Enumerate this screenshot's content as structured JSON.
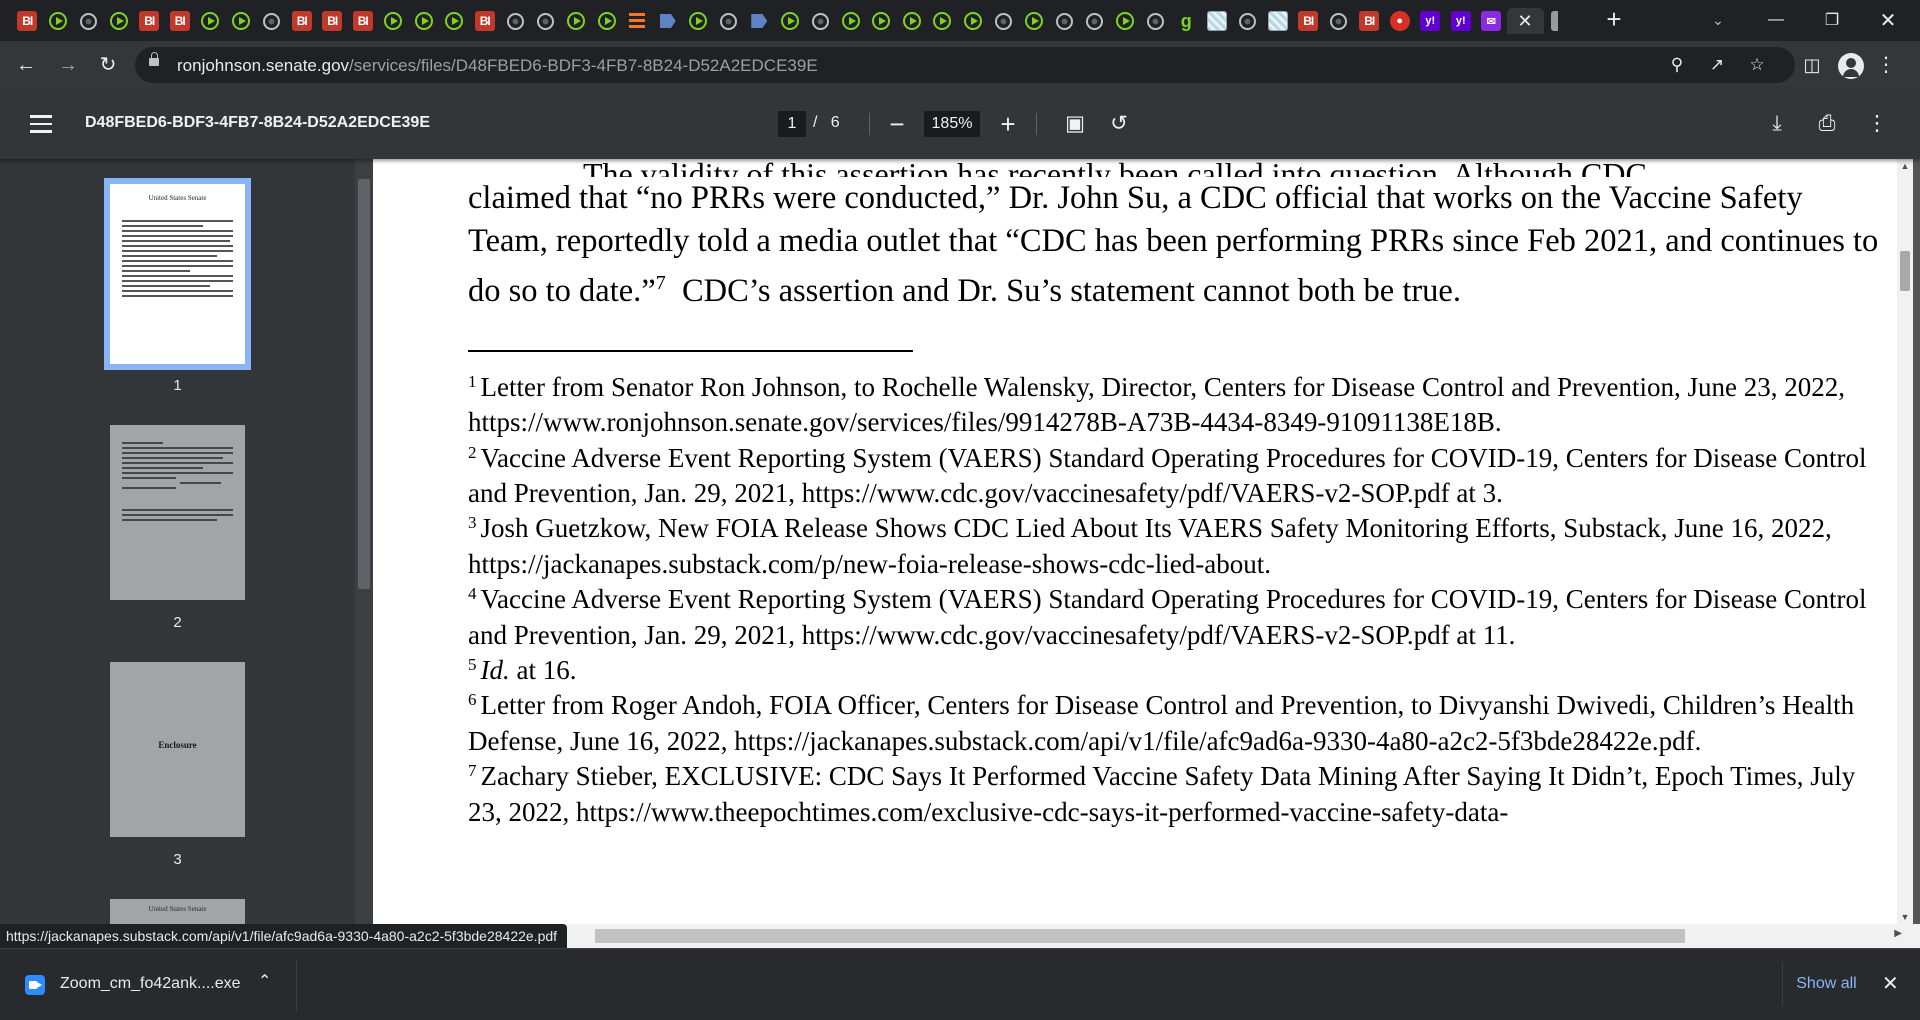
{
  "browser": {
    "tabs": [
      {
        "icon": "bi-icon",
        "text": "BI"
      },
      {
        "icon": "play-icon",
        "text": ""
      },
      {
        "icon": "globe-icon",
        "text": ""
      },
      {
        "icon": "play-icon",
        "text": ""
      },
      {
        "icon": "bi-icon",
        "text": "BI"
      },
      {
        "icon": "bi-icon",
        "text": "BI"
      },
      {
        "icon": "play-icon",
        "text": ""
      },
      {
        "icon": "play-icon",
        "text": ""
      },
      {
        "icon": "globe-icon",
        "text": ""
      },
      {
        "icon": "bi-icon",
        "text": "BI"
      },
      {
        "icon": "bi-icon",
        "text": "BI"
      },
      {
        "icon": "bi-icon",
        "text": "BI"
      },
      {
        "icon": "play-icon",
        "text": ""
      },
      {
        "icon": "play-icon",
        "text": ""
      },
      {
        "icon": "play-icon",
        "text": ""
      },
      {
        "icon": "bi-icon",
        "text": "BI"
      },
      {
        "icon": "globe-icon",
        "text": ""
      },
      {
        "icon": "globe-icon",
        "text": ""
      },
      {
        "icon": "play-icon",
        "text": ""
      },
      {
        "icon": "play-icon",
        "text": ""
      },
      {
        "icon": "orange-bars-icon",
        "text": ""
      },
      {
        "icon": "bookmark-icon",
        "text": ""
      },
      {
        "icon": "play-icon",
        "text": ""
      },
      {
        "icon": "globe-icon",
        "text": ""
      },
      {
        "icon": "bookmark-icon",
        "text": ""
      },
      {
        "icon": "play-icon",
        "text": ""
      },
      {
        "icon": "globe-icon",
        "text": ""
      },
      {
        "icon": "play-icon",
        "text": ""
      },
      {
        "icon": "play-icon",
        "text": ""
      },
      {
        "icon": "play-icon",
        "text": ""
      },
      {
        "icon": "play-icon",
        "text": ""
      },
      {
        "icon": "play-icon",
        "text": ""
      },
      {
        "icon": "globe-icon",
        "text": ""
      },
      {
        "icon": "play-icon",
        "text": ""
      },
      {
        "icon": "globe-icon",
        "text": ""
      },
      {
        "icon": "globe-icon",
        "text": ""
      },
      {
        "icon": "play-icon",
        "text": ""
      },
      {
        "icon": "globe-icon",
        "text": ""
      },
      {
        "icon": "g-icon",
        "text": "g"
      },
      {
        "icon": "grid-icon",
        "text": ""
      },
      {
        "icon": "globe-icon",
        "text": ""
      },
      {
        "icon": "grid-icon",
        "text": ""
      },
      {
        "icon": "bi-icon",
        "text": "BI"
      },
      {
        "icon": "globe-icon",
        "text": ""
      },
      {
        "icon": "bi-icon",
        "text": "BI"
      },
      {
        "icon": "red-pin-icon",
        "text": "●"
      },
      {
        "icon": "yahoo-icon",
        "text": "y!"
      },
      {
        "icon": "yahoo-icon",
        "text": "y!"
      },
      {
        "icon": "mail-icon",
        "text": "✉"
      },
      {
        "icon": "pdf-tab-icon",
        "text": "",
        "active": true
      },
      {
        "icon": "stripe-icon",
        "text": ""
      }
    ],
    "new_tab_symbol": "+",
    "url_host": "ronjohnson.senate.gov",
    "url_path": "/services/files/D48FBED6-BDF3-4FB7-8B24-D52A2EDCE39E",
    "accent_color": "#8ab4f8"
  },
  "pdf_toolbar": {
    "title": "D48FBED6-BDF3-4FB7-8B24-D52A2EDCE39E",
    "current_page": "1",
    "page_separator": "/",
    "total_pages": "6",
    "zoom": "185%"
  },
  "sidebar": {
    "thumbnails": [
      {
        "page": "1",
        "label": "United States Senate",
        "selected": true
      },
      {
        "page": "2",
        "label": "",
        "selected": false
      },
      {
        "page": "3",
        "label": "Enclosure",
        "selected": false
      },
      {
        "page": "4",
        "label": "United States Senate",
        "selected": false
      }
    ]
  },
  "document": {
    "cut_off_line": "The validity of this assertion has recently been called into question. Although CDC",
    "paragraph": "claimed that “no PRRs were conducted,” Dr. John Su, a CDC official that works on the Vaccine Safety Team, reportedly told a media outlet that “CDC has been performing PRRs since Feb 2021, and continues to do so to date.”",
    "paragraph_footnote_ref": "7",
    "paragraph_tail": "CDC’s assertion and Dr. Su’s statement cannot both be true.",
    "footnotes": [
      {
        "num": "1",
        "text": "Letter from Senator Ron Johnson, to Rochelle Walensky, Director, Centers for Disease Control and Prevention, June 23, 2022, https://www.ronjohnson.senate.gov/services/files/9914278B-A73B-4434-8349-91091138E18B."
      },
      {
        "num": "2",
        "text": "Vaccine Adverse Event Reporting System (VAERS) Standard Operating Procedures for COVID-19, Centers for Disease Control and Prevention, Jan. 29, 2021, https://www.cdc.gov/vaccinesafety/pdf/VAERS-v2-SOP.pdf at 3."
      },
      {
        "num": "3",
        "text": "Josh Guetzkow, New FOIA Release Shows CDC Lied About Its VAERS Safety Monitoring Efforts, Substack, June 16, 2022, https://jackanapes.substack.com/p/new-foia-release-shows-cdc-lied-about."
      },
      {
        "num": "4",
        "text": "Vaccine Adverse Event Reporting System (VAERS) Standard Operating Procedures for COVID-19, Centers for Disease Control and Prevention, Jan. 29, 2021, https://www.cdc.gov/vaccinesafety/pdf/VAERS-v2-SOP.pdf at 11."
      },
      {
        "num": "5",
        "italic": "Id.",
        "text": " at 16."
      },
      {
        "num": "6",
        "text": "Letter from Roger Andoh, FOIA Officer, Centers for Disease Control and Prevention, to Divyanshi Dwivedi, Children’s Health Defense, June 16, 2022, https://jackanapes.substack.com/api/v1/file/afc9ad6a-9330-4a80-a2c2-5f3bde28422e.pdf."
      },
      {
        "num": "7",
        "text": "Zachary Stieber, EXCLUSIVE: CDC Says It Performed Vaccine Safety Data Mining After Saying It Didn’t, Epoch Times, July 23, 2022, https://www.theepochtimes.com/exclusive-cdc-says-it-performed-vaccine-safety-data-"
      }
    ]
  },
  "status_url": "https://jackanapes.substack.com/api/v1/file/afc9ad6a-9330-4a80-a2c2-5f3bde28422e.pdf",
  "downloads": {
    "file_name": "Zoom_cm_fo42ank....exe",
    "show_all": "Show all"
  }
}
